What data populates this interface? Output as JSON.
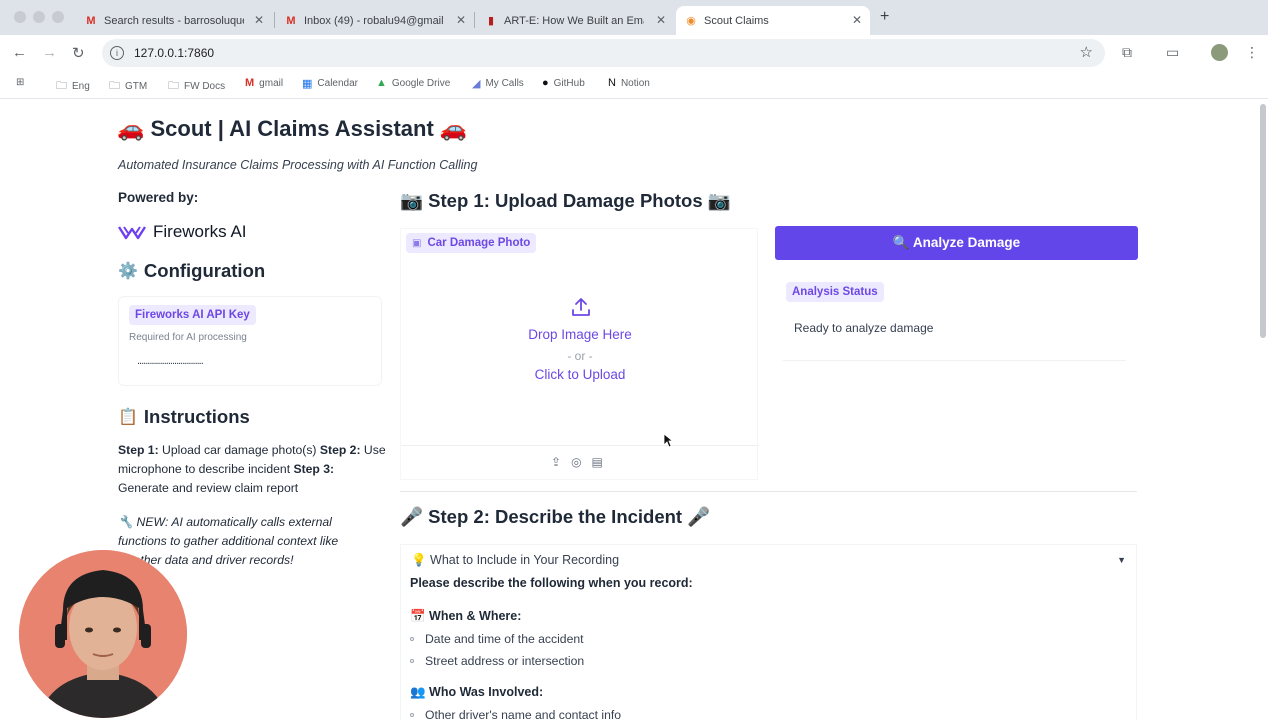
{
  "browser": {
    "tabs": [
      {
        "label": "Search results - barrosoluque"
      },
      {
        "label": "Inbox (49) - robalu94@gmail"
      },
      {
        "label": "ART-E: How We Built an Emai"
      },
      {
        "label": "Scout Claims"
      }
    ],
    "url": "127.0.0.1:7860",
    "bookmarks": [
      "Eng",
      "GTM",
      "FW Docs",
      "gmail",
      "Calendar",
      "Google Drive",
      "My Calls",
      "GitHub",
      "Notion"
    ]
  },
  "app": {
    "title": "🚗 Scout | AI Claims Assistant 🚗",
    "subtitle": "Automated Insurance Claims Processing with AI Function Calling"
  },
  "sidebar": {
    "powered_by": "Powered by:",
    "logo_text": "Fireworks AI",
    "configuration": {
      "emoji": "⚙️",
      "title": "Configuration",
      "api_key_label": "Fireworks AI API Key",
      "api_key_hint": "Required for AI processing",
      "api_key_value": "................................"
    },
    "instructions": {
      "emoji": "📋",
      "title": "Instructions",
      "step1_label": "Step 1:",
      "step1_text": " Upload car damage photo(s) ",
      "step2_label": "Step 2:",
      "step2_text": " Use microphone to describe incident ",
      "step3_label": "Step 3:",
      "step3_text": " Generate and review claim report",
      "note": "🔧 NEW: AI automatically calls external functions to gather additional context like weather data and driver records!"
    }
  },
  "step1": {
    "title": "📷 Step 1: Upload Damage Photos 📷",
    "upload_label": "Car Damage Photo",
    "drop_text": "Drop Image Here",
    "or_text": "- or -",
    "click_text": "Click to Upload",
    "analyze_button": "🔍 Analyze Damage",
    "status_label": "Analysis Status",
    "status_text": "Ready to analyze damage"
  },
  "step2": {
    "title": "🎤 Step 2: Describe the Incident 🎤",
    "accordion_title": "💡 What to Include in Your Recording",
    "intro": "Please describe the following when you record:",
    "when_where_title": "📅 When & Where:",
    "when_where_items": [
      "Date and time of the accident",
      "Street address or intersection"
    ],
    "who_title": "👥 Who Was Involved:",
    "who_items": [
      "Other driver's name and contact info"
    ]
  }
}
